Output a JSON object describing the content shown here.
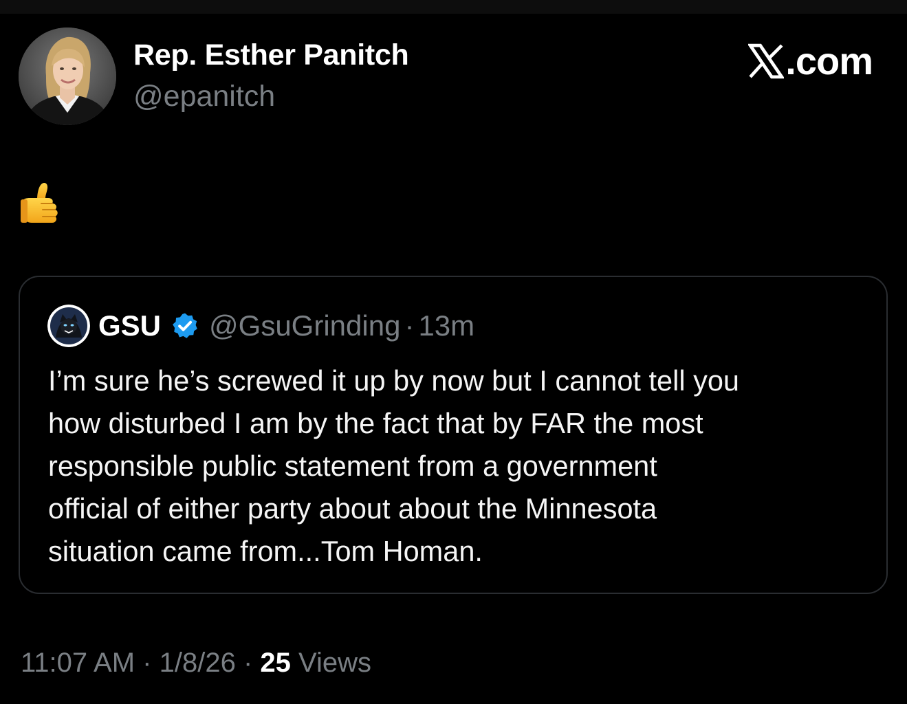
{
  "author": {
    "display_name": "Rep. Esther Panitch",
    "handle": "@epanitch",
    "avatar_icon": "profile-photo"
  },
  "site_logo": {
    "icon": "x-logo-icon",
    "text": ".com"
  },
  "post": {
    "emoji_icon": "thumbs-up-emoji"
  },
  "quoted_post": {
    "display_name": "GSU",
    "verified": true,
    "verified_color": "#1d9bf0",
    "handle": "@GsuGrinding",
    "separator": "·",
    "time": "13m",
    "text": "I’m sure he’s screwed it up by now but I cannot tell you\nhow disturbed I am by the fact that by FAR the  most\nresponsible public statement from a government\nofficial of either party about about the Minnesota\nsituation  came from...Tom Homan."
  },
  "meta": {
    "time": "11:07 AM",
    "separator": "·",
    "date": "1/8/26",
    "views_count": "25",
    "views_label": "Views"
  },
  "colors": {
    "background": "#000000",
    "text_primary": "#ffffff",
    "text_secondary": "#7a7f84",
    "card_border": "#2a2d31"
  }
}
